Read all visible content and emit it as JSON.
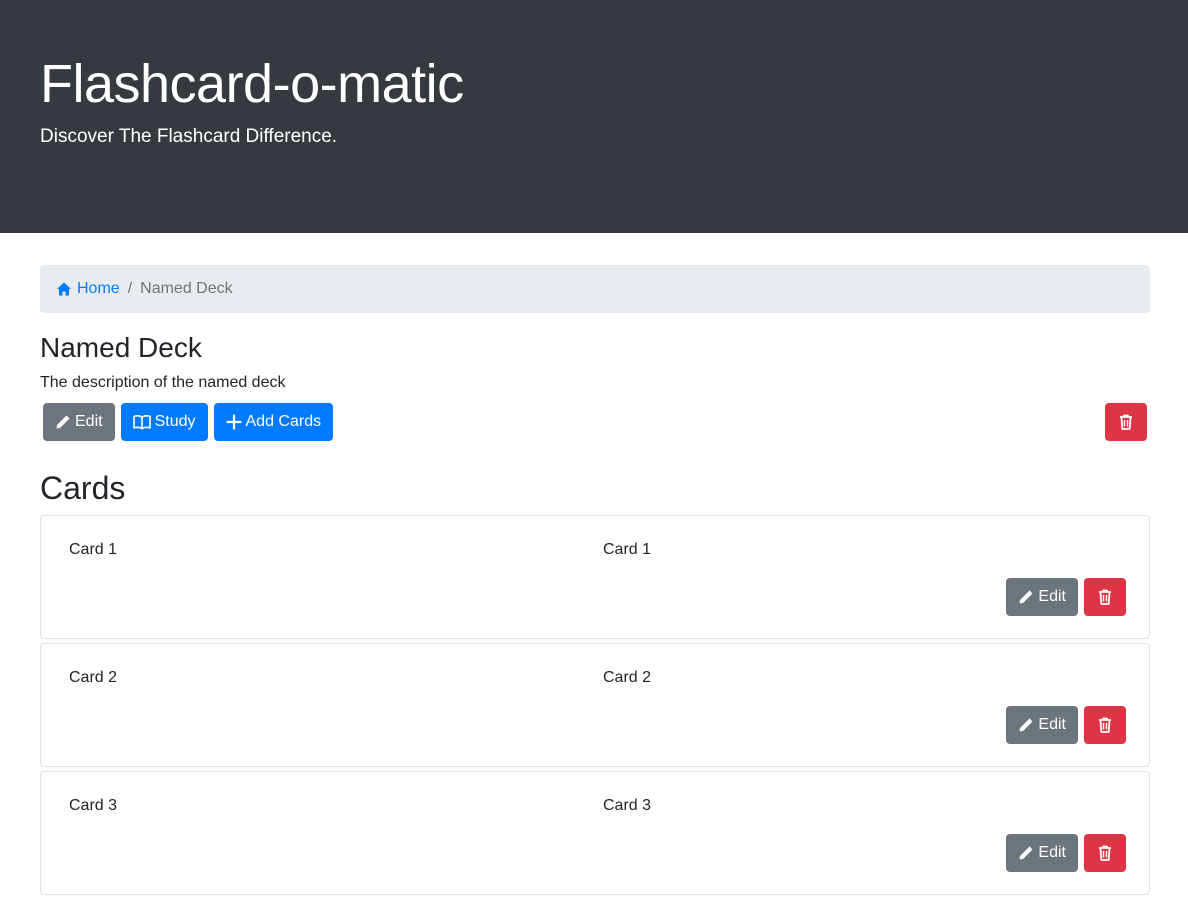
{
  "header": {
    "title": "Flashcard-o-matic",
    "tagline": "Discover The Flashcard Difference."
  },
  "breadcrumb": {
    "home_label": "Home",
    "separator": "/",
    "current": "Named Deck"
  },
  "deck": {
    "name": "Named Deck",
    "description": "The description of the named deck",
    "actions": {
      "edit_label": "Edit",
      "study_label": "Study",
      "add_cards_label": "Add Cards"
    }
  },
  "cards_heading": "Cards",
  "cards": [
    {
      "front": "Card 1",
      "back": "Card 1",
      "edit_label": "Edit"
    },
    {
      "front": "Card 2",
      "back": "Card 2",
      "edit_label": "Edit"
    },
    {
      "front": "Card 3",
      "back": "Card 3",
      "edit_label": "Edit"
    }
  ],
  "colors": {
    "header_bg": "#343a40",
    "primary": "#007bff",
    "secondary": "#6c757d",
    "danger": "#dc3545",
    "breadcrumb_bg": "#e9ecef"
  },
  "icons": {
    "home": "home-icon",
    "edit": "pencil-icon",
    "study": "book-icon",
    "add": "plus-icon",
    "delete": "trash-icon"
  }
}
